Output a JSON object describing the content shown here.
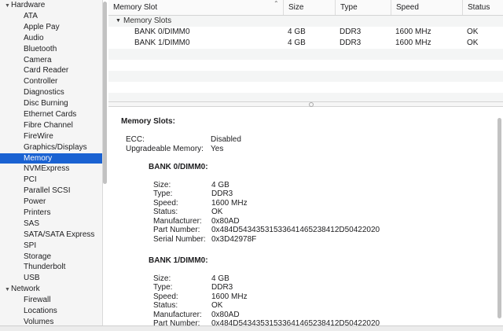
{
  "sidebar": {
    "groups": [
      {
        "label": "Hardware",
        "expanded": true
      },
      {
        "label": "Network",
        "expanded": true
      }
    ],
    "hardware_items": [
      "ATA",
      "Apple Pay",
      "Audio",
      "Bluetooth",
      "Camera",
      "Card Reader",
      "Controller",
      "Diagnostics",
      "Disc Burning",
      "Ethernet Cards",
      "Fibre Channel",
      "FireWire",
      "Graphics/Displays",
      "Memory",
      "NVMExpress",
      "PCI",
      "Parallel SCSI",
      "Power",
      "Printers",
      "SAS",
      "SATA/SATA Express",
      "SPI",
      "Storage",
      "Thunderbolt",
      "USB"
    ],
    "network_items": [
      "Firewall",
      "Locations",
      "Volumes"
    ],
    "selected": "Memory"
  },
  "table": {
    "columns": [
      "Memory Slot",
      "Size",
      "Type",
      "Speed",
      "Status"
    ],
    "section": "Memory Slots",
    "rows": [
      [
        "BANK 0/DIMM0",
        "4 GB",
        "DDR3",
        "1600 MHz",
        "OK"
      ],
      [
        "BANK 1/DIMM0",
        "4 GB",
        "DDR3",
        "1600 MHz",
        "OK"
      ]
    ]
  },
  "detail": {
    "heading": "Memory Slots:",
    "ecc_label": "ECC:",
    "ecc_value": "Disabled",
    "upgradeable_label": "Upgradeable Memory:",
    "upgradeable_value": "Yes",
    "banks": [
      {
        "title": "BANK 0/DIMM0:",
        "fields": [
          [
            "Size:",
            "4 GB"
          ],
          [
            "Type:",
            "DDR3"
          ],
          [
            "Speed:",
            "1600 MHz"
          ],
          [
            "Status:",
            "OK"
          ],
          [
            "Manufacturer:",
            "0x80AD"
          ],
          [
            "Part Number:",
            "0x484D54343531533641465238412D50422020"
          ],
          [
            "Serial Number:",
            "0x3D42978F"
          ]
        ]
      },
      {
        "title": "BANK 1/DIMM0:",
        "fields": [
          [
            "Size:",
            "4 GB"
          ],
          [
            "Type:",
            "DDR3"
          ],
          [
            "Speed:",
            "1600 MHz"
          ],
          [
            "Status:",
            "OK"
          ],
          [
            "Manufacturer:",
            "0x80AD"
          ],
          [
            "Part Number:",
            "0x484D54343531533641465238412D50422020"
          ]
        ]
      }
    ]
  },
  "icons": {
    "sort": "chevron-up-icon",
    "disclosure": "disclosure-triangle-icon"
  },
  "colors": {
    "selection": "#1a62d2"
  }
}
